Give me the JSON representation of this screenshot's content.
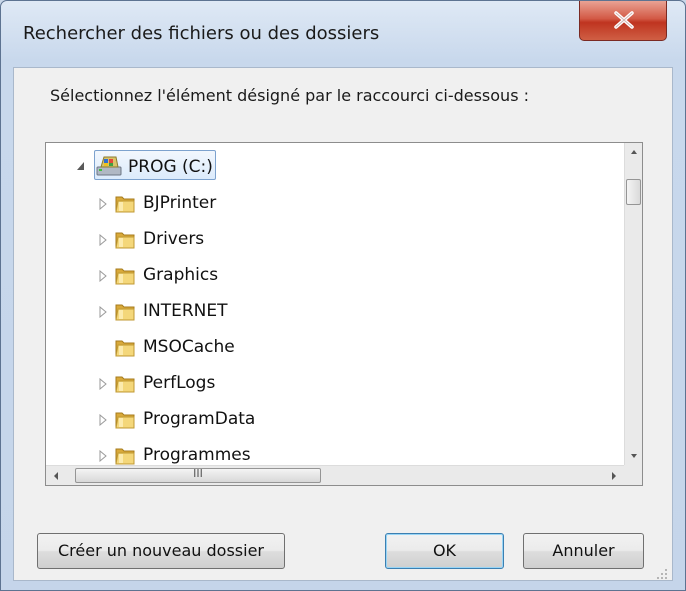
{
  "window": {
    "title": "Rechercher des fichiers ou des dossiers",
    "close_glyph": "X"
  },
  "instruction": "Sélectionnez l'élément désigné par le raccourci ci-dessous :",
  "tree": {
    "root": {
      "label": "PROG (C:)",
      "icon": "drive-icon",
      "expanded": true,
      "selected": true
    },
    "items": [
      {
        "label": "BJPrinter",
        "has_children": true
      },
      {
        "label": "Drivers",
        "has_children": true
      },
      {
        "label": "Graphics",
        "has_children": true
      },
      {
        "label": "INTERNET",
        "has_children": true
      },
      {
        "label": "MSOCache",
        "has_children": false
      },
      {
        "label": "PerfLogs",
        "has_children": true
      },
      {
        "label": "ProgramData",
        "has_children": true
      },
      {
        "label": "Programmes",
        "has_children": true
      }
    ]
  },
  "scrollbar": {
    "h_grip": "III"
  },
  "buttons": {
    "new_folder": "Créer un nouveau dossier",
    "ok": "OK",
    "cancel": "Annuler"
  },
  "colors": {
    "close_red": "#c8452f",
    "folder_yellow": "#e8c35a",
    "selection_blue": "#7da2ce"
  }
}
